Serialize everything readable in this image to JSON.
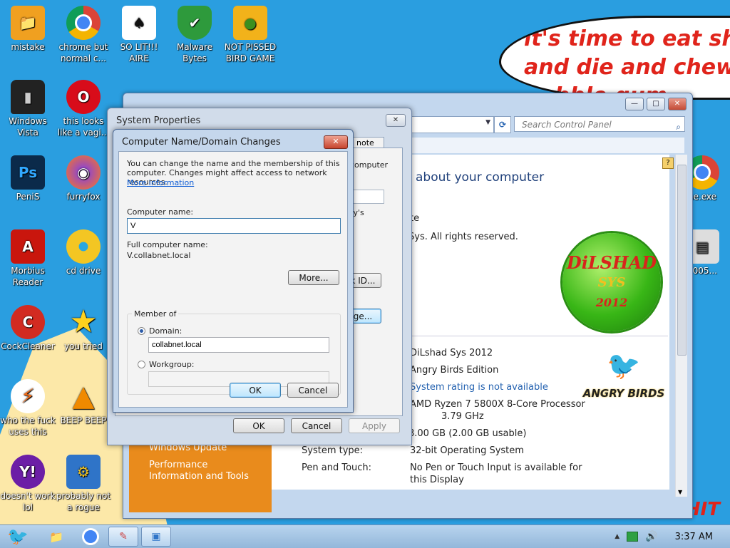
{
  "wallpaper": {
    "bubble_lines": [
      "it's time to eat shit",
      "and die and chew",
      "bubble gum"
    ],
    "bottom_text": "BULLSHIT"
  },
  "desktop_icons": [
    {
      "label": "mistake",
      "icon": "user-folder-icon",
      "color": "#f0a020"
    },
    {
      "label": "chrome but normal c...",
      "icon": "chrome-icon",
      "color": "#4285f4"
    },
    {
      "label": "SO LIT!!! AIRE",
      "icon": "solitaire-icon",
      "color": "#ffffff"
    },
    {
      "label": "Malware Bytes",
      "icon": "shield-icon",
      "color": "#2e9a3c"
    },
    {
      "label": "NOT PISSED BIRD GAME",
      "icon": "bad-piggies-icon",
      "color": "#f2b21a"
    },
    {
      "label": "Windows Vista",
      "icon": "trash-bin-icon",
      "color": "#222222"
    },
    {
      "label": "this looks like a vagi...",
      "icon": "opera-icon",
      "color": "#d80c1a"
    },
    {
      "label": "PeniS",
      "icon": "photoshop-icon",
      "color": "#0b2a4a"
    },
    {
      "label": "furryfox",
      "icon": "firefox-icon",
      "color": "#ff7a1a"
    },
    {
      "label": "Morbius Reader",
      "icon": "acrobat-icon",
      "color": "#c9160d"
    },
    {
      "label": "cd drive",
      "icon": "cd-icon",
      "color": "#f3c623"
    },
    {
      "label": "CockCleaner",
      "icon": "ccleaner-icon",
      "color": "#d22b21"
    },
    {
      "label": "you tried",
      "icon": "star-icon",
      "color": "#ffd21e"
    },
    {
      "label": "who the fuck uses this",
      "icon": "winamp-icon",
      "color": "#ef6c1a"
    },
    {
      "label": "BEEP BEEP",
      "icon": "vlc-icon",
      "color": "#f08a00"
    },
    {
      "label": "doesn't work lol",
      "icon": "yahoo-icon",
      "color": "#6c1ea6"
    },
    {
      "label": "probably not a rogue",
      "icon": "settings-computer-icon",
      "color": "#2f74c8"
    },
    {
      "label": "ne.exe",
      "icon": "chrome-icon",
      "color": "#4285f4"
    },
    {
      "label": "5005...",
      "icon": "file-icon",
      "color": "#dddddd"
    }
  ],
  "control_panel": {
    "search_placeholder": "Search Control Panel",
    "title": "about your computer",
    "copyright_1": "te",
    "copyright_2": "Sys.  All rights reserved.",
    "logo_text": [
      "DiLSHAD",
      "SYS",
      "2012"
    ],
    "logo_ab_text": "ANGRY BIRDS",
    "sidebar_links": [
      "Windows Update",
      "Performance Information and Tools"
    ],
    "info": [
      {
        "label": "",
        "value": "DiLshad Sys 2012"
      },
      {
        "label": "",
        "value": "Angry Birds Edition"
      },
      {
        "label": "",
        "value": "System rating is not available",
        "link": true
      },
      {
        "label": "",
        "value": "AMD Ryzen 7 5800X 8-Core Processor",
        "value2": "3.79 GHz"
      },
      {
        "label": "",
        "value": "8.00 GB (2.00 GB usable)"
      },
      {
        "label": "System type:",
        "value": "32-bit Operating System"
      },
      {
        "label": "Pen and Touch:",
        "value": "No Pen or Touch Input is available for",
        "value2": "this Display"
      }
    ]
  },
  "system_properties": {
    "title": "System Properties",
    "tab_fragment": "note",
    "frag_computer": "computer",
    "frag_rys": "ry's",
    "netid_fragment": "k ID...",
    "change_fragment": "ge...",
    "ok": "OK",
    "cancel": "Cancel",
    "apply": "Apply"
  },
  "computer_name_dialog": {
    "title": "Computer Name/Domain Changes",
    "description": "You can change the name and the membership of this computer. Changes might affect access to network resources.",
    "more_info_link": "More information",
    "computer_name_label": "Computer name:",
    "computer_name_value": "V",
    "full_name_label": "Full computer name:",
    "full_name_value": "V.collabnet.local",
    "more_button": "More...",
    "member_of_label": "Member of",
    "domain_label": "Domain:",
    "domain_value": "collabnet.local",
    "workgroup_label": "Workgroup:",
    "workgroup_value": "",
    "selected": "domain",
    "ok": "OK",
    "cancel": "Cancel"
  },
  "taskbar": {
    "clock": "3:37 AM",
    "items": [
      "start-button",
      "explorer-icon",
      "chrome-icon",
      "app-icon",
      "system-properties-icon"
    ]
  }
}
